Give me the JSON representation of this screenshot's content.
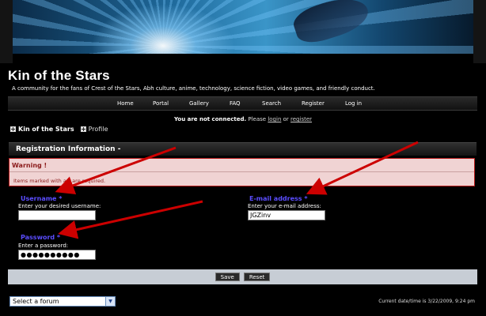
{
  "site": {
    "title": "Kin of the Stars",
    "description": "A community for the fans of Crest of the Stars, Abh culture, anime, technology, science fiction, video games, and friendly conduct."
  },
  "nav": {
    "items": [
      "Home",
      "Portal",
      "Gallery",
      "FAQ",
      "Search",
      "Register",
      "Log in"
    ]
  },
  "connection": {
    "status": "You are not connected.",
    "prompt": "Please",
    "login": "login",
    "or": "or",
    "register": "register"
  },
  "breadcrumb": {
    "items": [
      "Kin of the Stars",
      "Profile"
    ]
  },
  "section": {
    "title": "Registration Information -"
  },
  "warning": {
    "title": "Warning !",
    "text": "Items marked with a * are required."
  },
  "form": {
    "username": {
      "label": "Username *",
      "hint": "Enter your desired username:",
      "value": ""
    },
    "email": {
      "label": "E-mail address *",
      "hint": "Enter your e-mail address:",
      "value": "JGZinv"
    },
    "password": {
      "label": "Password *",
      "hint": "Enter a password:",
      "value": "●●●●●●●●●●"
    }
  },
  "buttons": {
    "save": "Save",
    "reset": "Reset"
  },
  "footer": {
    "forum_select": "Select a forum",
    "datetime": "Current date/time is 3/22/2009, 9:24 pm"
  },
  "colors": {
    "label_accent": "#5b4dff",
    "warning_bg": "#f0d3d3",
    "warning_text": "#8b1b1b",
    "arrow": "#cc0000"
  }
}
